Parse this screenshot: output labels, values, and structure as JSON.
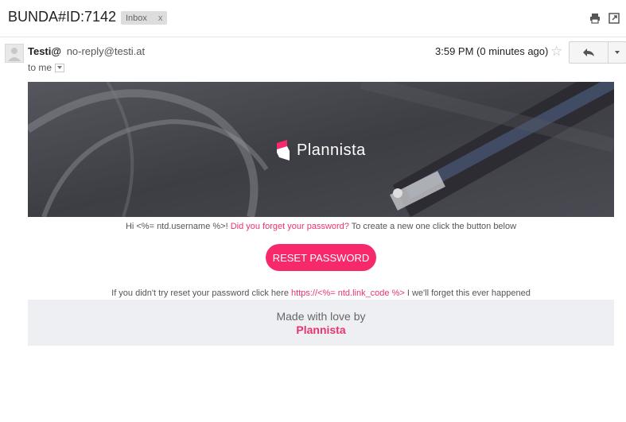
{
  "subject": "BUNDA#ID:7142",
  "label_chip": {
    "text": "Inbox",
    "remove": "x"
  },
  "icons": {
    "print": "print-icon",
    "popout": "popout-icon",
    "avatar": "person-icon",
    "star": "star-icon",
    "reply": "reply-icon",
    "more": "chevron-down-icon"
  },
  "message": {
    "sender_name": "Testi@",
    "sender_email": "no-reply@testi.at",
    "to": "to me",
    "time": "3:59 PM (0 minutes ago)"
  },
  "email": {
    "brand": "Plannista",
    "greeting_pre": "Hi <%= ntd.username %>!",
    "greeting_link": "Did you forget your password?",
    "greeting_post": "To create a new one click the button below",
    "reset_button": "RESET PASSWORD",
    "ignore_pre": "If you didn't try reset your password click here",
    "ignore_link": "https://<%= ntd.link_code %>",
    "ignore_post": "I we'll forget this ever happened",
    "footer_text": "Made with love by",
    "footer_brand": "Plannista"
  },
  "colors": {
    "accent": "#f7296b",
    "link": "#e8346e",
    "banner": "#3f3f46",
    "footer_bg": "#eeeff2"
  }
}
